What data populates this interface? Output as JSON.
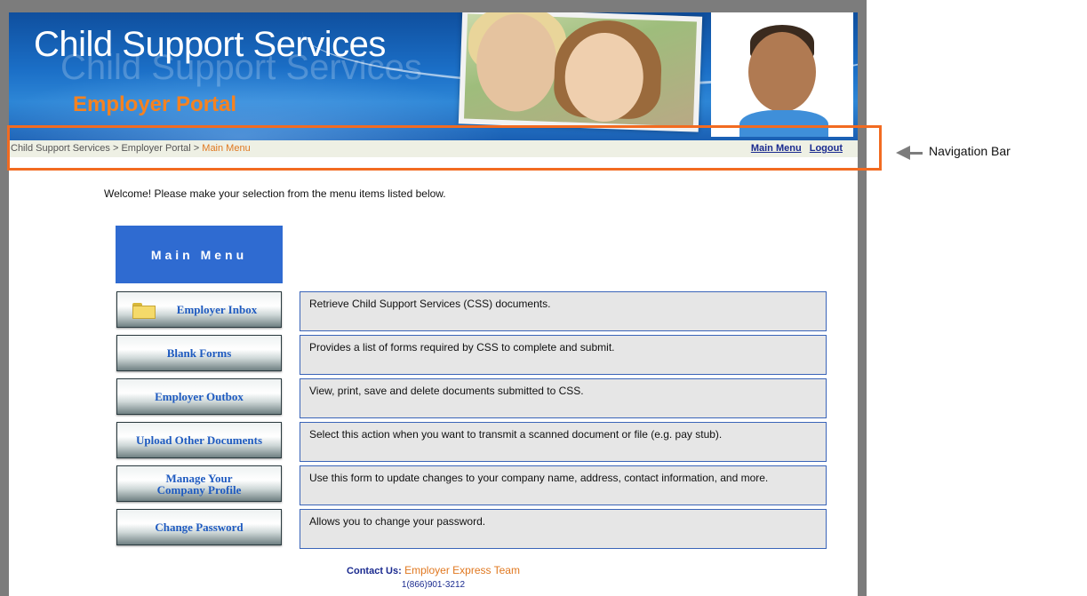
{
  "header": {
    "title": "Child Support Services",
    "subtitle": "Employer Portal"
  },
  "nav": {
    "breadcrumb": {
      "part1": "Child Support Services",
      "sep": ">",
      "part2": "Employer Portal",
      "current": "Main Menu"
    },
    "links": {
      "main_menu": "Main Menu",
      "logout": "Logout"
    }
  },
  "welcome": "Welcome! Please make your selection from the menu items listed below.",
  "menu": {
    "title": "Main Menu",
    "items": [
      {
        "label": "Employer Inbox",
        "icon": "folder-icon",
        "description": "Retrieve Child Support Services (CSS) documents."
      },
      {
        "label": "Blank Forms",
        "description": "Provides a list of forms required by CSS to complete and submit."
      },
      {
        "label": "Employer Outbox",
        "description": "View, print, save and delete documents submitted to CSS."
      },
      {
        "label": "Upload Other Documents",
        "description": "Select this action when you want to transmit a scanned document or file (e.g. pay stub)."
      },
      {
        "label_line1": "Manage Your",
        "label_line2": "Company Profile",
        "description": "Use this form to update changes to your company name, address, contact information, and more."
      },
      {
        "label": "Change Password",
        "description": "Allows you to change your password."
      }
    ]
  },
  "contact": {
    "label": "Contact Us:",
    "team": "Employer Express Team",
    "phone": "1(866)901-3212"
  },
  "annotation": {
    "label": "Navigation Bar"
  },
  "colors": {
    "accent_blue": "#2f6bd1",
    "orange": "#f26b21",
    "link_blue": "#1a2a8f"
  }
}
